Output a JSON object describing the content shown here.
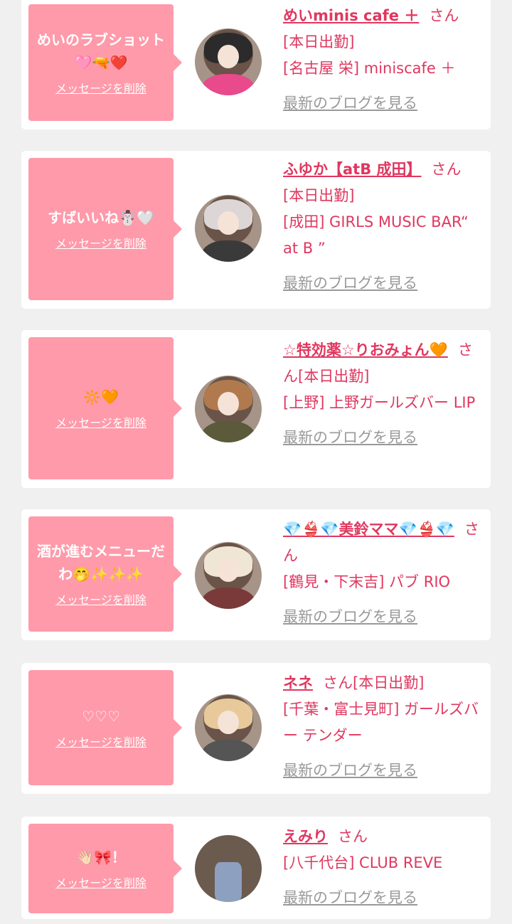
{
  "messages": [
    {
      "bubble": "めいのラブショット🩷🔫❤️",
      "delete_label": "メッセージを削除",
      "name": "めいminis cafe ＋",
      "san": "さん",
      "status": "[本日出勤]",
      "shop": "[名古屋 栄] miniscafe ＋",
      "blog_label": "最新のブログを見る"
    },
    {
      "bubble": "すばいいね☃️🤍",
      "delete_label": "メッセージを削除",
      "name": "ふゆか【atB 成田】",
      "san": "さん",
      "status": "[本日出勤]",
      "shop": "[成田] GIRLS MUSIC BAR“ at B ”",
      "blog_label": "最新のブログを見る"
    },
    {
      "bubble": "🔆🧡",
      "delete_label": "メッセージを削除",
      "name": "☆特効薬☆りおみょん🧡",
      "san": "さん",
      "status": "[本日出勤]",
      "shop": "[上野] 上野ガールズバー LIP",
      "blog_label": "最新のブログを見る"
    },
    {
      "bubble": "酒が進むメニューだわ🤭✨✨✨",
      "delete_label": "メッセージを削除",
      "name": "💎👙💎美鈴ママ💎👙💎",
      "san": "さん",
      "status": "",
      "shop": "[鶴見・下末吉] パブ RIO",
      "blog_label": "最新のブログを見る"
    },
    {
      "bubble": "♡♡♡",
      "delete_label": "メッセージを削除",
      "name": "ネネ",
      "san": "さん",
      "status": "[本日出勤]",
      "shop": "[千葉・富士見町] ガールズバー テンダー",
      "blog_label": "最新のブログを見る"
    },
    {
      "bubble": "👋🏻🎀！",
      "delete_label": "メッセージを削除",
      "name": "えみり",
      "san": "さん",
      "status": "",
      "shop": "[八千代台] CLUB REVE",
      "blog_label": "最新のブログを見る"
    }
  ],
  "colors": {
    "bubble": "#ff9aaa",
    "accent": "#e0375f",
    "link_gray": "#999999",
    "background": "#f0f0f0"
  }
}
